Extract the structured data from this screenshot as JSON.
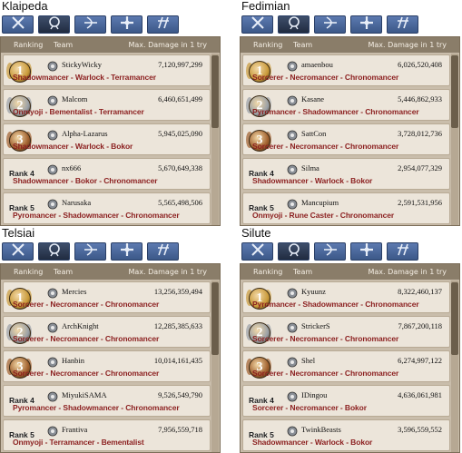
{
  "header": {
    "ranking": "Ranking",
    "team": "Team",
    "max_damage": "Max. Damage in 1 try"
  },
  "panels": [
    {
      "title": "Klaipeda",
      "rows": [
        {
          "rank": "1",
          "name": "StickyWicky",
          "damage": "7,120,997,299",
          "classes": "Shadowmancer - Warlock - Terramancer"
        },
        {
          "rank": "2",
          "name": "Malcom",
          "damage": "6,460,651,499",
          "classes": "Onmyoji - Bementalist - Terramancer"
        },
        {
          "rank": "3",
          "name": "Alpha-Lazarus",
          "damage": "5,945,025,090",
          "classes": "Shadowmancer - Warlock - Bokor"
        },
        {
          "rank": "Rank 4",
          "name": "nx666",
          "damage": "5,670,649,338",
          "classes": "Shadowmancer - Bokor - Chronomancer"
        },
        {
          "rank": "Rank 5",
          "name": "Narusaka",
          "damage": "5,565,498,506",
          "classes": "Pyromancer - Shadowmancer - Chronomancer"
        }
      ]
    },
    {
      "title": "Fedimian",
      "rows": [
        {
          "rank": "1",
          "name": "amaenbou",
          "damage": "6,026,520,408",
          "classes": "Sorcerer - Necromancer - Chronomancer"
        },
        {
          "rank": "2",
          "name": "Kasane",
          "damage": "5,446,862,933",
          "classes": "Pyromancer - Shadowmancer - Chronomancer"
        },
        {
          "rank": "3",
          "name": "SattCon",
          "damage": "3,728,012,736",
          "classes": "Sorcerer - Necromancer - Chronomancer"
        },
        {
          "rank": "Rank 4",
          "name": "Silma",
          "damage": "2,954,077,329",
          "classes": "Shadowmancer - Warlock - Bokor"
        },
        {
          "rank": "Rank 5",
          "name": "Mancupium",
          "damage": "2,591,531,956",
          "classes": "Onmyoji - Rune Caster - Chronomancer"
        }
      ]
    },
    {
      "title": "Telsiai",
      "rows": [
        {
          "rank": "1",
          "name": "Mercies",
          "damage": "13,256,359,494",
          "classes": "Sorcerer - Necromancer - Chronomancer"
        },
        {
          "rank": "2",
          "name": "ArchKnight",
          "damage": "12,285,385,633",
          "classes": "Sorcerer - Necromancer - Chronomancer"
        },
        {
          "rank": "3",
          "name": "Hanbin",
          "damage": "10,014,161,435",
          "classes": "Sorcerer - Necromancer - Chronomancer"
        },
        {
          "rank": "Rank 4",
          "name": "MiyukiSAMA",
          "damage": "9,526,549,790",
          "classes": "Pyromancer - Shadowmancer - Chronomancer"
        },
        {
          "rank": "Rank 5",
          "name": "Frantiva",
          "damage": "7,956,559,718",
          "classes": "Onmyoji - Terramancer - Bementalist"
        }
      ]
    },
    {
      "title": "Silute",
      "rows": [
        {
          "rank": "1",
          "name": "Kyuunz",
          "damage": "8,322,460,137",
          "classes": "Pyromancer - Shadowmancer - Chronomancer"
        },
        {
          "rank": "2",
          "name": "StrickerS",
          "damage": "7,867,200,118",
          "classes": "Sorcerer - Necromancer - Chronomancer"
        },
        {
          "rank": "3",
          "name": "Shel",
          "damage": "6,274,997,122",
          "classes": "Sorcerer - Necromancer - Chronomancer"
        },
        {
          "rank": "Rank 4",
          "name": "IDingou",
          "damage": "4,636,061,981",
          "classes": "Sorcerer - Necromancer - Bokor"
        },
        {
          "rank": "Rank 5",
          "name": "TwinkBeasts",
          "damage": "3,596,559,552",
          "classes": "Shadowmancer - Warlock - Bokor"
        }
      ]
    }
  ],
  "tab_icons": [
    "swordsman-class-icon",
    "wizard-class-icon",
    "archer-class-icon",
    "cleric-class-icon",
    "scout-class-icon"
  ],
  "medal_colors": {
    "gold": "#c99a3a",
    "silver": "#9aa0a6",
    "bronze": "#a0602e"
  }
}
